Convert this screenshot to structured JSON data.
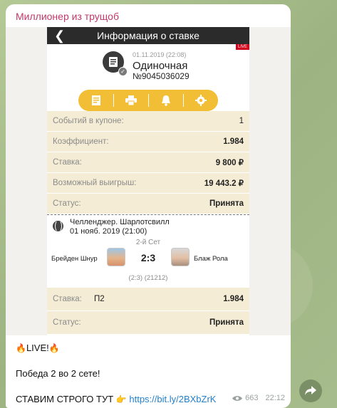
{
  "channel": {
    "name": "Миллионер из трущоб"
  },
  "app": {
    "title": "Информация о ставке",
    "live_tag": "LIVE"
  },
  "bet": {
    "date": "01.11.2019 (22:08)",
    "type": "Одиночная",
    "number": "№9045036029"
  },
  "actions": [
    {
      "icon": "receipt-icon"
    },
    {
      "icon": "print-icon"
    },
    {
      "icon": "bell-icon"
    },
    {
      "icon": "settings-gear-icon"
    }
  ],
  "summary": [
    {
      "label": "Событий в купоне:",
      "value": "1"
    },
    {
      "label": "Коэффициент:",
      "value": "1.984"
    },
    {
      "label": "Ставка:",
      "value": "9 800 ₽"
    },
    {
      "label": "Возможный выигрыш:",
      "value": "19 443.2 ₽"
    },
    {
      "label": "Статус:",
      "value": "Принята"
    }
  ],
  "event": {
    "tournament": "Челленджер. Шарлотсвилл",
    "date": "01 нояб. 2019 (21:00)",
    "set": "2-й Сет",
    "player1": "Брейден Шнур",
    "score": "2:3",
    "player2": "Блаж Рола",
    "sets_detail": "(2:3) (21212)"
  },
  "outcome": {
    "stake_label": "Ставка:",
    "stake_pick": "П2",
    "stake_odds": "1.984",
    "status_label": "Статус:",
    "status_value": "Принята"
  },
  "message": {
    "live_text": "LIVE!",
    "line2": "Победа 2 во 2 сете!",
    "line3": "СТАВИМ СТРОГО ТУТ",
    "link": "https://bit.ly/2BXbZrK",
    "views": "663",
    "time": "22:12"
  },
  "colors": {
    "accent_yellow": "#f1be35",
    "row_bg": "#f4ecd4",
    "channel_name": "#c2386a",
    "link": "#2481cc"
  }
}
